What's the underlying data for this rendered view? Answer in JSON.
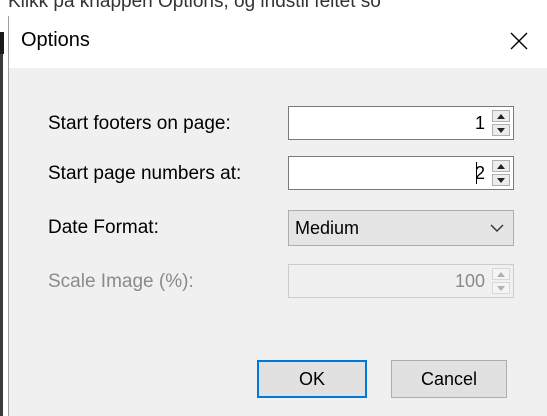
{
  "background_text": "Klikk på knappen Options, og indstil feltet so",
  "dialog": {
    "title": "Options",
    "fields": [
      {
        "label": "Start footers on page:",
        "value": "1",
        "enabled": true
      },
      {
        "label": "Start page numbers at:",
        "value": "2",
        "enabled": true
      },
      {
        "label": "Date Format:",
        "value": "Medium",
        "enabled": true
      },
      {
        "label": "Scale Image (%):",
        "value": "100",
        "enabled": false
      }
    ],
    "ok_label": "OK",
    "cancel_label": "Cancel"
  },
  "icons": {
    "close": "close-icon",
    "spin_up": "arrow-up-icon",
    "spin_down": "arrow-down-icon",
    "dropdown": "chevron-down-icon"
  },
  "colors": {
    "dialog_bg": "#f0f0f0",
    "accent": "#0078d7",
    "disabled_text": "#8a8a8a"
  }
}
